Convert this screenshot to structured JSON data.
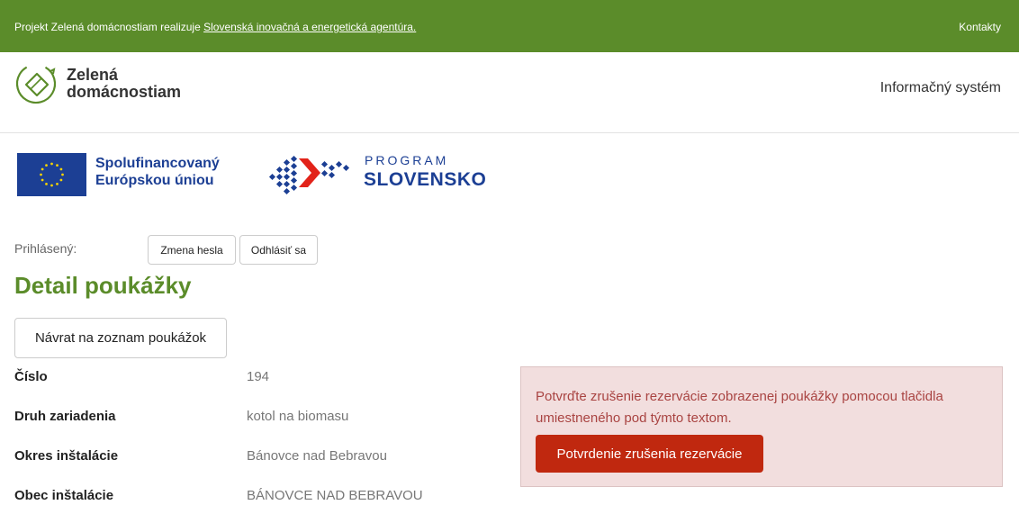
{
  "topbar": {
    "intro": "Projekt Zelená domácnostiam realizuje ",
    "agency_link": "Slovenská inovačná a energetická agentúra.",
    "contacts": "Kontakty"
  },
  "header": {
    "logo_line1": "Zelená",
    "logo_line2": "domácnostiam",
    "info_system": "Informačný systém"
  },
  "sponsors": {
    "eu_line1": "Spolufinancovaný",
    "eu_line2": "Európskou úniou",
    "program_line1": "PROGRAM",
    "program_line2": "SLOVENSKO"
  },
  "user": {
    "logged_label": "Prihlásený:",
    "change_password": "Zmena hesla",
    "logout": "Odhlásiť sa"
  },
  "page": {
    "title": "Detail poukážky",
    "back_button": "Návrat na zoznam poukážok"
  },
  "details": [
    {
      "label": "Číslo",
      "value": "194"
    },
    {
      "label": "Druh zariadenia",
      "value": "kotol na biomasu"
    },
    {
      "label": "Okres inštalácie",
      "value": "Bánovce nad Bebravou"
    },
    {
      "label": "Obec inštalácie",
      "value": "BÁNOVCE NAD BEBRAVOU"
    }
  ],
  "alert": {
    "message": "Potvrďte zrušenie rezervácie zobrazenej poukážky pomocou tlačidla umiestneného pod týmto textom.",
    "confirm_button": "Potvrdenie zrušenia rezervácie"
  },
  "colors": {
    "brand_green": "#5b8c2a",
    "alert_bg": "#f2dede",
    "alert_text": "#a94442",
    "danger_button": "#c0280f",
    "eu_blue": "#1c3f94"
  }
}
